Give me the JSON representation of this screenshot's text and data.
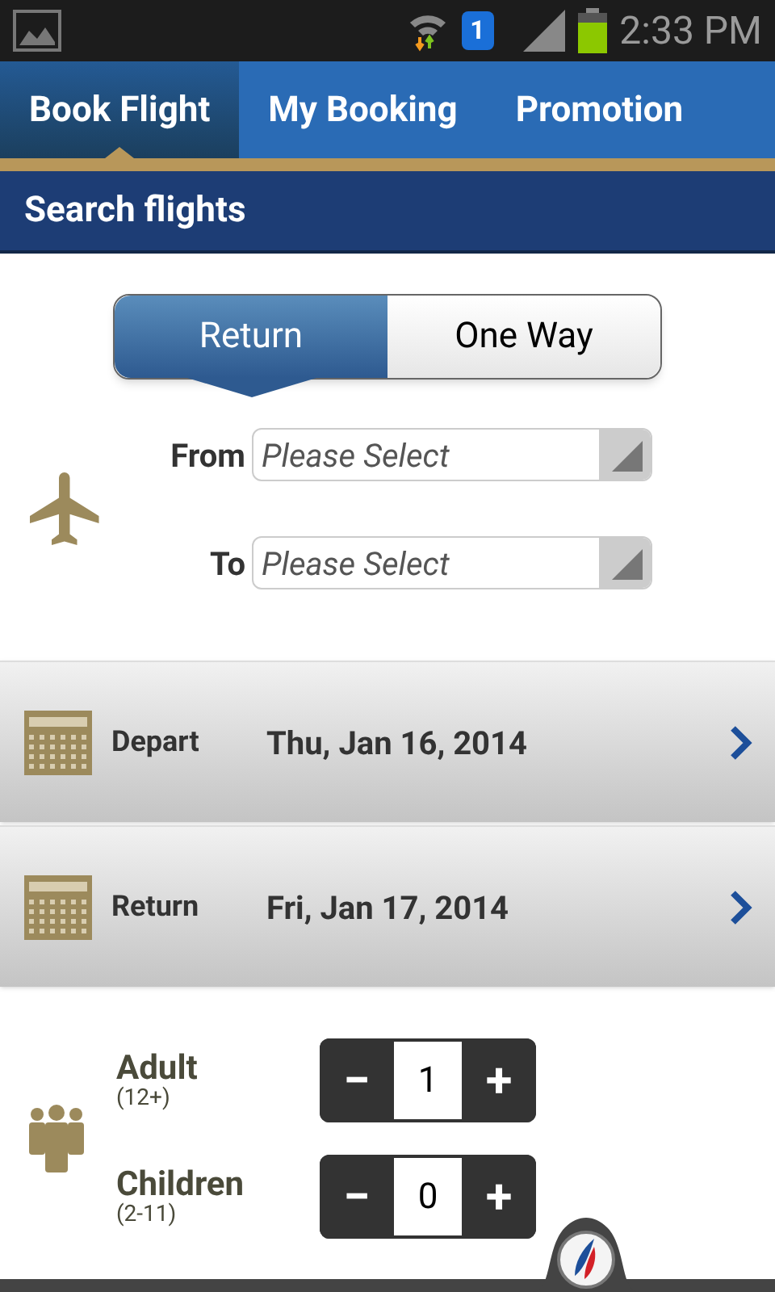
{
  "status_bar": {
    "sim_badge": "1",
    "time": "2:33 PM"
  },
  "tabs": [
    {
      "label": "Book Flight",
      "selected": true
    },
    {
      "label": "My Booking",
      "selected": false
    },
    {
      "label": "Promotion",
      "selected": false
    }
  ],
  "header": {
    "title": "Search flights"
  },
  "trip_type": [
    {
      "label": "Return",
      "selected": true
    },
    {
      "label": "One Way",
      "selected": false
    }
  ],
  "route": [
    {
      "label": "From",
      "placeholder": "Please Select"
    },
    {
      "label": "To",
      "placeholder": "Please Select"
    }
  ],
  "dates": [
    {
      "label": "Depart",
      "value": "Thu, Jan 16, 2014"
    },
    {
      "label": "Return",
      "value": "Fri, Jan 17, 2014"
    }
  ],
  "passengers": [
    {
      "label": "Adult",
      "range": "(12+)",
      "minus": "−",
      "count": "1",
      "plus": "+"
    },
    {
      "label": "Children",
      "range": "(2-11)",
      "minus": "−",
      "count": "0",
      "plus": "+"
    }
  ]
}
